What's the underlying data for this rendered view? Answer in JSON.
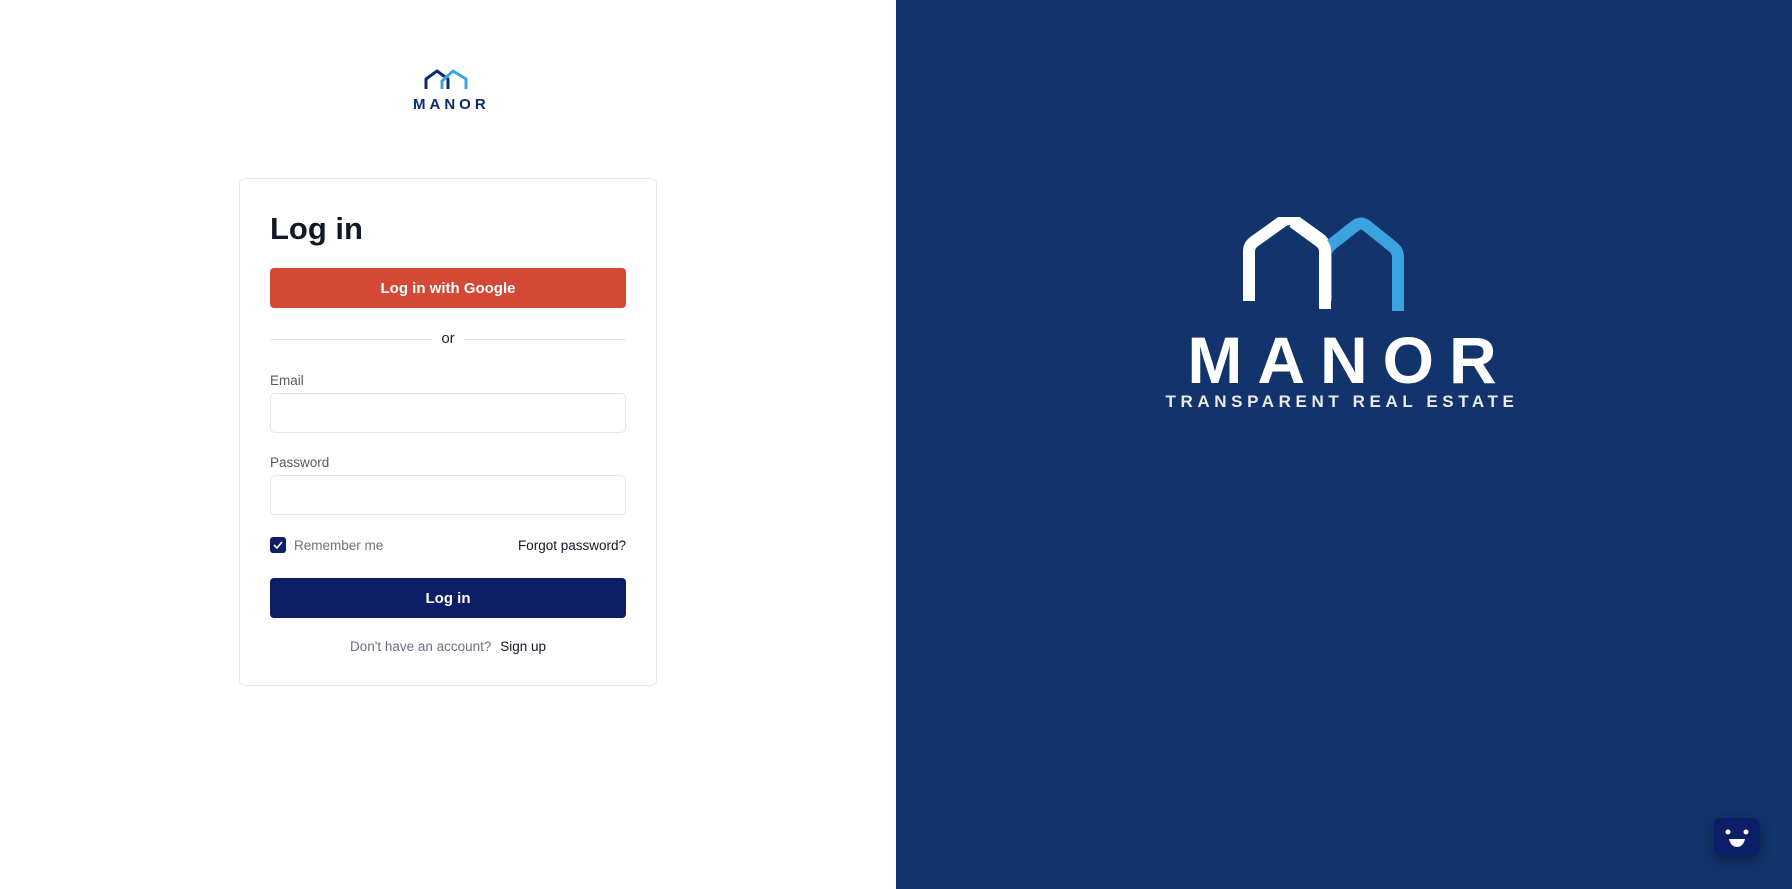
{
  "brand": {
    "name": "MANOR",
    "tagline": "TRANSPARENT REAL ESTATE",
    "navy": "#0c1f66",
    "blue": "#3ba3e0",
    "panel": "#12336b"
  },
  "login": {
    "title": "Log in",
    "google_button": "Log in with Google",
    "divider": "or",
    "email_label": "Email",
    "email_value": "",
    "password_label": "Password",
    "password_value": "",
    "remember_label": "Remember me",
    "remember_checked": true,
    "forgot_link": "Forgot password?",
    "submit_button": "Log in",
    "signup_prompt": "Don't have an account?",
    "signup_link": "Sign up"
  },
  "chat_widget": {
    "icon": "smiley-chat-icon"
  }
}
